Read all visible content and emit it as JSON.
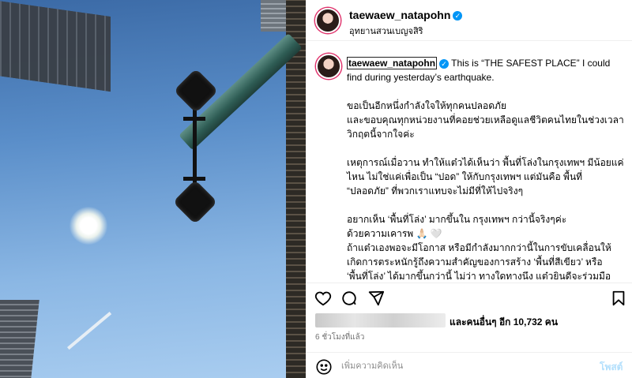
{
  "post": {
    "username": "taewaew_natapohn",
    "verified_icon": "verified-badge-icon",
    "location": "อุทยานสวนเบญจสิริ",
    "caption": {
      "first_line": "This is “THE SAFEST PLACE” I could find during yesterday’s earthquake.",
      "para1": "ขอเป็นอีกหนึ่งกำลังใจให้ทุกคนปลอดภัย\nและขอบคุณทุกหน่วยงานที่คอยช่วยเหลือดูแลชีวิตคนไทยในช่วงเวลาวิกฤตนี้จากใจค่ะ",
      "para2": "เหตุการณ์เมื่อวาน ทำให้แต๋วได้เห็นว่า พื้นที่โล่งในกรุงเทพฯ มีน้อยแค่ไหน ไม่ใช่แค่เพื่อเป็น “ปอด” ให้กับกรุงเทพฯ แต่มันคือ พื้นที่ “ปลอดภัย” ที่พวกเราแทบจะไม่มีที่ให้ไปจริงๆ",
      "para3": "อยากเห็น ‘พื้นที่โล่ง’ มากขึ้นใน กรุงเทพฯ กว่านี้จริงๆค่ะ\nด้วยความเคารพ 🙏🏻 🤍\nถ้าแต๋วเองพอจะมีโอกาส หรือมีกำลังมากกว่านี้ในการขับเคลื่อนให้เกิดการตระหนักรู้ถึงความสำคัญของการสร้าง ‘พื้นที่สีเขียว’ หรือ ‘พื้นที่โล่ง’ ได้มากขึ้นกว่านี้ ไม่ว่า ทางใดทางนึง แต๋วยินดีจะร่วมมืออย่างเต็มที่ จึงขอใช้ “พื้นที่เล็กๆ” นี้ เปิดโอกาสให้ตัวเองได้มีเสียงในฐานะประชาชนที่อยากเห็นกรุงเทพฯ ได้เป็น “เมืองที่น่าอยู่จริงๆ” ขึ้นกว่านี้ด้วยอีกคนค่ะ"
    },
    "likes_text": "และคนอื่นๆ อีก 10,732 คน",
    "time_ago": "6 ชั่วโมงที่แล้ว",
    "comment_placeholder": "เพิ่มความคิดเห็น",
    "post_button": "โพสต์"
  },
  "icons": {
    "like": "heart-icon",
    "comment": "comment-icon",
    "share": "share-icon",
    "save": "bookmark-icon",
    "emoji": "emoji-icon"
  },
  "colors": {
    "verified": "#0095f6",
    "post_button": "#b2dffc",
    "story_ring": "#e0336c"
  }
}
